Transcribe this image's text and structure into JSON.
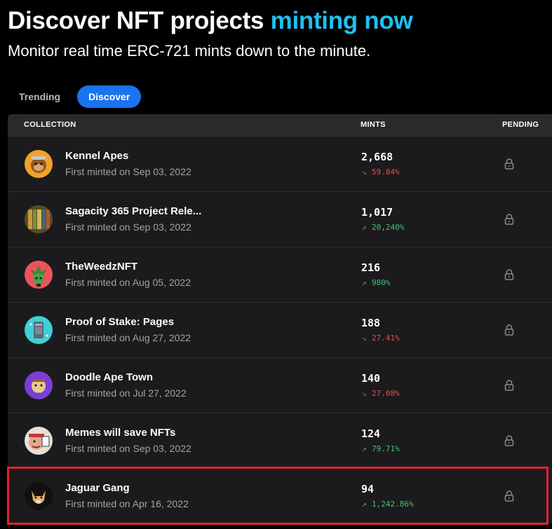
{
  "hero": {
    "title_main": "Discover NFT projects ",
    "title_accent": "minting now",
    "subtitle": "Monitor real time ERC-721 mints down to the minute.",
    "accent_color": "#1fc0ef"
  },
  "tabs": [
    {
      "label": "Trending",
      "active": false
    },
    {
      "label": "Discover",
      "active": true
    }
  ],
  "table": {
    "headers": {
      "collection": "COLLECTION",
      "mints": "MINTS",
      "pending": "PENDING"
    },
    "rows": [
      {
        "name": "Kennel Apes",
        "first_minted": "First minted on Sep 03, 2022",
        "mints": "2,668",
        "change": "59.84%",
        "direction": "down",
        "avatar_icon": "ape-avatar-icon",
        "pending_icon": "lock-icon"
      },
      {
        "name": "Sagacity 365 Project Rele...",
        "first_minted": "First minted on Sep 03, 2022",
        "mints": "1,017",
        "change": "20,240%",
        "direction": "up",
        "avatar_icon": "bookshelf-avatar-icon",
        "pending_icon": "lock-icon"
      },
      {
        "name": "TheWeedzNFT",
        "first_minted": "First minted on Aug 05, 2022",
        "mints": "216",
        "change": "980%",
        "direction": "up",
        "avatar_icon": "weed-character-avatar-icon",
        "pending_icon": "lock-icon"
      },
      {
        "name": "Proof of Stake: Pages",
        "first_minted": "First minted on Aug 27, 2022",
        "mints": "188",
        "change": "27.41%",
        "direction": "down",
        "avatar_icon": "page-card-avatar-icon",
        "pending_icon": "lock-icon"
      },
      {
        "name": "Doodle Ape Town",
        "first_minted": "First minted on Jul 27, 2022",
        "mints": "140",
        "change": "27.08%",
        "direction": "down",
        "avatar_icon": "doodle-ape-avatar-icon",
        "pending_icon": "lock-icon"
      },
      {
        "name": "Memes will save NFTs",
        "first_minted": "First minted on Sep 03, 2022",
        "mints": "124",
        "change": "79.71%",
        "direction": "up",
        "avatar_icon": "meme-face-avatar-icon",
        "pending_icon": "lock-icon"
      },
      {
        "name": "Jaguar Gang",
        "first_minted": "First minted on Apr 16, 2022",
        "mints": "94",
        "change": "1,242.86%",
        "direction": "up",
        "avatar_icon": "jaguar-avatar-icon",
        "pending_icon": "lock-icon",
        "highlighted": true
      }
    ]
  },
  "colors": {
    "background": "#000000",
    "table_bg": "#1b1b1d",
    "header_bg": "#2a2a2d",
    "active_tab": "#1a74f0",
    "up": "#46c372",
    "down": "#f0474a",
    "highlight_border": "#e3232a"
  }
}
